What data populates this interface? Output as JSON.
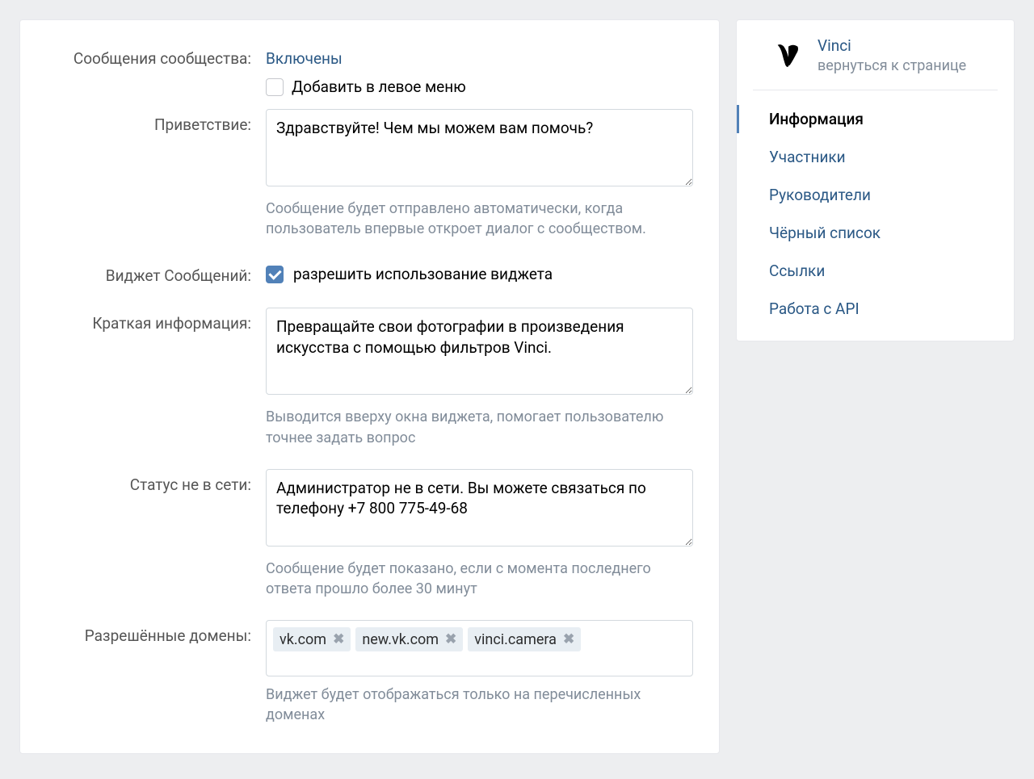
{
  "form": {
    "messages": {
      "label": "Сообщения сообщества:",
      "status": "Включены",
      "add_to_menu": "Добавить в левое меню"
    },
    "greeting": {
      "label": "Приветствие:",
      "value": "Здравствуйте! Чем мы можем вам помочь?",
      "hint": "Сообщение будет отправлено автоматически, когда пользователь впервые откроет диалог с сообществом."
    },
    "widget": {
      "label": "Виджет Сообщений:",
      "allow": "разрешить использование виджета"
    },
    "brief": {
      "label": "Краткая информация:",
      "value": "Превращайте свои фотографии в произведения искусства с помощью фильтров Vinci.",
      "hint": "Выводится вверху окна виджета, помогает пользователю точнее задать вопрос"
    },
    "offline": {
      "label": "Статус не в сети:",
      "value": "Администратор не в сети. Вы можете связаться по телефону +7 800 775-49-68",
      "hint": "Сообщение будет показано, если с момента последнего ответа прошло более 30 минут"
    },
    "domains": {
      "label": "Разрешённые домены:",
      "items": [
        "vk.com",
        "new.vk.com",
        "vinci.camera"
      ],
      "hint": "Виджет будет отображаться только на перечисленных доменах"
    }
  },
  "sidebar": {
    "title": "Vinci",
    "back": "вернуться к странице",
    "nav": [
      {
        "label": "Информация",
        "active": true
      },
      {
        "label": "Участники",
        "active": false
      },
      {
        "label": "Руководители",
        "active": false
      },
      {
        "label": "Чёрный список",
        "active": false
      },
      {
        "label": "Ссылки",
        "active": false
      },
      {
        "label": "Работа с API",
        "active": false
      }
    ]
  }
}
